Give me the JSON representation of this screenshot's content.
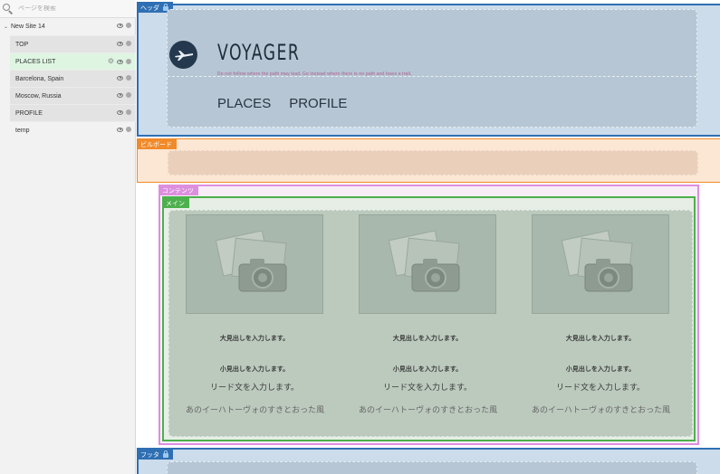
{
  "sidebar": {
    "search": {
      "placeholder": "ページを検索"
    },
    "site": {
      "name": "New Site 14"
    },
    "pages": [
      {
        "label": "TOP"
      },
      {
        "label": "PLACES LIST"
      },
      {
        "label": "Barcelona, Spain"
      },
      {
        "label": "Moscow, Russia"
      },
      {
        "label": "PROFILE"
      },
      {
        "label": "temp"
      }
    ]
  },
  "canvas": {
    "header": {
      "tag": "ヘッダ",
      "title": "VOYAGER",
      "tagline": "Do not follow where the path may lead. Go instead where there is no path and leave a trail.",
      "nav": [
        "PLACES",
        "PROFILE"
      ]
    },
    "billboard": {
      "tag": "ビルボード"
    },
    "content": {
      "tag": "コンテンツ"
    },
    "main": {
      "tag": "メイン",
      "cards": [
        {
          "heading": "大見出しを入力します。",
          "subheading": "小見出しを入力します。",
          "lead": "リード文を入力します。",
          "body": "あのイーハトーヴォのすきとおった風"
        },
        {
          "heading": "大見出しを入力します。",
          "subheading": "小見出しを入力します。",
          "lead": "リード文を入力します。",
          "body": "あのイーハトーヴォのすきとおった風"
        },
        {
          "heading": "大見出しを入力します。",
          "subheading": "小見出しを入力します。",
          "lead": "リード文を入力します。",
          "body": "あのイーハトーヴォのすきとおった風"
        }
      ]
    },
    "footer": {
      "tag": "フッタ"
    }
  },
  "colors": {
    "header_tag": "#2f6fb3",
    "billboard_tag": "#f08a2a",
    "content_tag": "#dd8fdf",
    "main_tag": "#4cb04c",
    "selected_page": "#def5e2"
  }
}
